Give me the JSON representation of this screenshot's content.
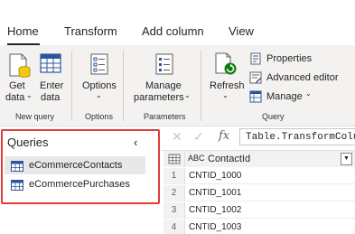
{
  "tabs": [
    {
      "label": "Home",
      "active": true
    },
    {
      "label": "Transform",
      "active": false
    },
    {
      "label": "Add column",
      "active": false
    },
    {
      "label": "View",
      "active": false
    }
  ],
  "ribbon": {
    "new_query": {
      "group_label": "New query",
      "get_data_line1": "Get",
      "get_data_line2": "data",
      "enter_data_line1": "Enter",
      "enter_data_line2": "data"
    },
    "options": {
      "group_label": "Options",
      "options_label": "Options"
    },
    "parameters": {
      "group_label": "Parameters",
      "manage_line1": "Manage",
      "manage_line2": "parameters"
    },
    "query": {
      "group_label": "Query",
      "refresh_label": "Refresh",
      "properties_label": "Properties",
      "advanced_editor_label": "Advanced editor",
      "manage_label": "Manage"
    }
  },
  "queries_pane": {
    "title": "Queries",
    "collapse_glyph": "‹",
    "items": [
      {
        "label": "eCommerceContacts",
        "selected": true
      },
      {
        "label": "eCommercePurchases",
        "selected": false
      }
    ]
  },
  "formula_bar": {
    "cancel_glyph": "✕",
    "commit_glyph": "✓",
    "fx_label": "fx",
    "formula": "Table.TransformColum"
  },
  "grid": {
    "column_type_label": "ABC",
    "column_header": "ContactId",
    "rows": [
      {
        "num": "1",
        "value": "CNTID_1000"
      },
      {
        "num": "2",
        "value": "CNTID_1001"
      },
      {
        "num": "3",
        "value": "CNTID_1002"
      },
      {
        "num": "4",
        "value": "CNTID_1003"
      }
    ]
  },
  "colors": {
    "highlight_border": "#e03c3c",
    "ribbon_bg": "#f3f2f1",
    "accent_blue": "#2b579a",
    "refresh_green": "#107c10"
  }
}
